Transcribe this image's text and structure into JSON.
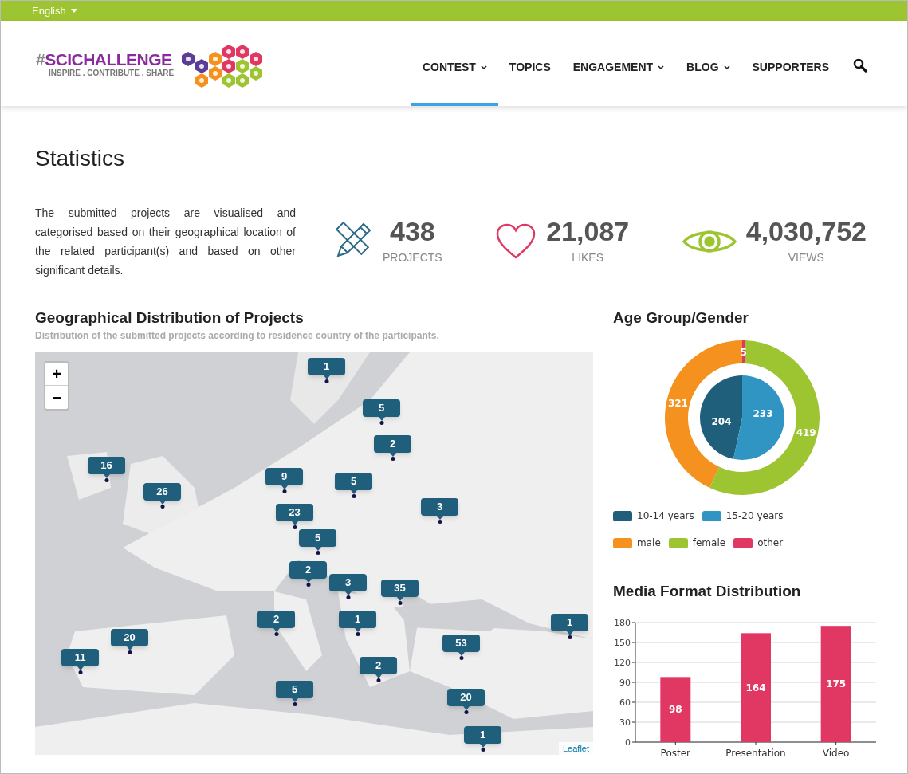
{
  "topbar": {
    "language": "English"
  },
  "logo": {
    "hash": "#",
    "name": "SCICHALLENGE",
    "tagline": "INSPIRE . CONTRIBUTE . SHARE"
  },
  "nav": [
    {
      "label": "CONTEST",
      "dropdown": true,
      "selected": true
    },
    {
      "label": "TOPICS",
      "dropdown": false,
      "selected": false
    },
    {
      "label": "ENGAGEMENT",
      "dropdown": true,
      "selected": false
    },
    {
      "label": "BLOG",
      "dropdown": true,
      "selected": false
    },
    {
      "label": "SUPPORTERS",
      "dropdown": false,
      "selected": false
    }
  ],
  "page_title": "Statistics",
  "intro": "The submitted projects are visualised and categorised based on their geographical location of the related participant(s) and based on other significant details.",
  "stats": [
    {
      "kind": "projects",
      "value": "438",
      "label": "PROJECTS"
    },
    {
      "kind": "likes",
      "value": "21,087",
      "label": "LIKES"
    },
    {
      "kind": "views",
      "value": "4,030,752",
      "label": "VIEWS"
    }
  ],
  "map_section": {
    "title": "Geographical Distribution of Projects",
    "subtitle": "Distribution of the submitted projects according to residence country of the participants.",
    "zoom_in": "+",
    "zoom_out": "−",
    "attribution": "Leaflet",
    "markers": [
      {
        "count": "1"
      },
      {
        "count": "5"
      },
      {
        "count": "2"
      },
      {
        "count": "16"
      },
      {
        "count": "9"
      },
      {
        "count": "5"
      },
      {
        "count": "26"
      },
      {
        "count": "23"
      },
      {
        "count": "3"
      },
      {
        "count": "5"
      },
      {
        "count": "2"
      },
      {
        "count": "3"
      },
      {
        "count": "35"
      },
      {
        "count": "2"
      },
      {
        "count": "1"
      },
      {
        "count": "1"
      },
      {
        "count": "20"
      },
      {
        "count": "53"
      },
      {
        "count": "11"
      },
      {
        "count": "2"
      },
      {
        "count": "5"
      },
      {
        "count": "20"
      },
      {
        "count": "1"
      }
    ]
  },
  "age_gender": {
    "title": "Age Group/Gender",
    "age_chart": {
      "chart_data": {
        "type": "pie",
        "categories": [
          "10-14 years",
          "15-20 years"
        ],
        "values": [
          204,
          233
        ],
        "data_labels": true
      }
    },
    "gender_chart": {
      "chart_data": {
        "type": "donut",
        "categories": [
          "male",
          "female",
          "other"
        ],
        "values": [
          321,
          419,
          5
        ],
        "data_labels": true
      }
    },
    "legend_colors": [
      {
        "color": "#1f5f7b"
      },
      {
        "color": "#3195c4"
      },
      {
        "color": "#f5911e"
      },
      {
        "color": "#9dc431"
      },
      {
        "color": "#e03763"
      }
    ]
  },
  "media_format": {
    "title": "Media Format Distribution",
    "chart_data": {
      "type": "bar",
      "categories": [
        "Poster",
        "Presentation",
        "Video"
      ],
      "series": [
        {
          "color": "#e03763",
          "values": [
            98,
            164,
            175
          ]
        }
      ],
      "ylim": [
        0,
        180
      ],
      "grid": true,
      "yticks": [
        0,
        30,
        60,
        90,
        120,
        150,
        180
      ],
      "data_labels": true
    }
  }
}
